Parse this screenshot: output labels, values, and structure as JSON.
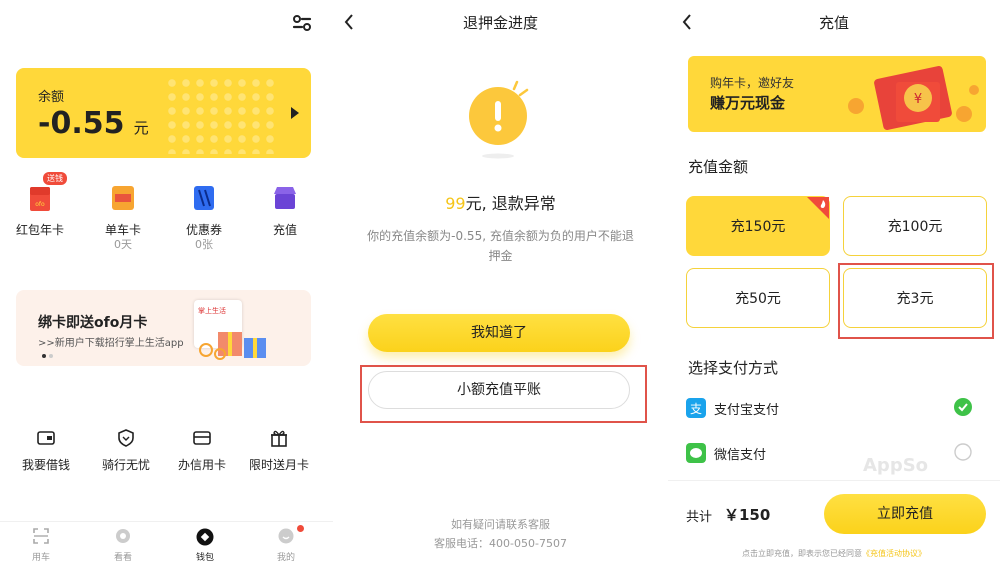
{
  "wallet": {
    "balance_label": "余额",
    "balance_value": "-0.55",
    "balance_unit": "元",
    "tiles": [
      {
        "label": "红包年卡",
        "badge": "送钱",
        "sub": ""
      },
      {
        "label": "单车卡",
        "sub": "0天"
      },
      {
        "label": "优惠券",
        "sub": "0张"
      },
      {
        "label": "充值",
        "sub": ""
      }
    ],
    "banner": {
      "title": "绑卡即送ofo月卡",
      "subtitle": ">>新用户下载招行掌上生活app",
      "card_brand": "掌上生活"
    },
    "actions": [
      "我要借钱",
      "骑行无忧",
      "办信用卡",
      "限时送月卡"
    ],
    "nav": [
      "用车",
      "看看",
      "钱包",
      "我的"
    ]
  },
  "refund": {
    "title": "退押金进度",
    "amount": "99",
    "amount_rest": "元, 退款异常",
    "desc": "你的充值余额为-0.55, 充值余额为负的用户不能退押金",
    "btn_primary": "我知道了",
    "btn_secondary": "小额充值平账",
    "help": "如有疑问请联系客服",
    "phone": "客服电话：400-050-7507"
  },
  "recharge": {
    "title": "充值",
    "banner_line1": "购年卡，邀好友",
    "banner_line2": "赚万元现金",
    "amount_heading": "充值金额",
    "amounts": [
      "充150元",
      "充100元",
      "充50元",
      "充3元"
    ],
    "pay_heading": "选择支付方式",
    "pay": [
      "支付宝支付",
      "微信支付"
    ],
    "total_label": "共计",
    "total_value": "￥150",
    "pay_btn": "立即充值",
    "agree": "点击立即充值，即表示您已经同意",
    "agree_link": "《充值活动协议》",
    "watermark": "AppSo"
  },
  "colors": {
    "accent": "#ffd83a",
    "alipay": "#1aa3ec",
    "wechat": "#3ec248",
    "check": "#3ec248",
    "alert": "#e0534a"
  }
}
